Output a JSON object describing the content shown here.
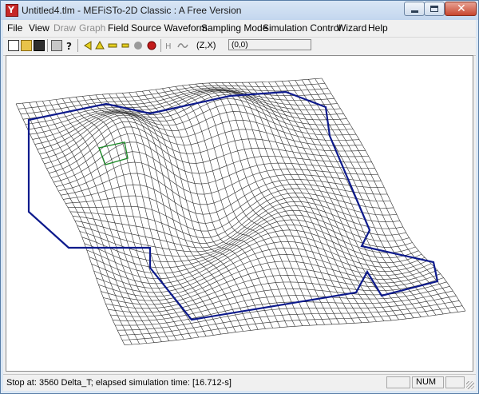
{
  "window": {
    "title": "Untitled4.tlm - MEFiSTo-2D Classic : A Free Version",
    "app_icon_glyph": "Y"
  },
  "menu": [
    {
      "label": "File",
      "enabled": true
    },
    {
      "label": "View",
      "enabled": true
    },
    {
      "label": "Draw",
      "enabled": false
    },
    {
      "label": "Graph",
      "enabled": false
    },
    {
      "label": "Field",
      "enabled": true
    },
    {
      "label": "Source Waveform",
      "enabled": true
    },
    {
      "label": "Sampling Mode",
      "enabled": true
    },
    {
      "label": "Simulation Control",
      "enabled": true
    },
    {
      "label": "Wizard",
      "enabled": true
    },
    {
      "label": "Help",
      "enabled": true
    }
  ],
  "toolbar": {
    "buttons": [
      "new-file-icon",
      "open-folder-icon",
      "save-icon",
      "print-icon",
      "help-question-icon",
      "step-back-icon",
      "step-up-icon",
      "zoom-out-icon",
      "stop-icon",
      "pause-icon",
      "record-icon",
      "run-probe-icon",
      "waveform-icon"
    ],
    "coord_label": "(Z,X)",
    "coord_value": "(0,0)"
  },
  "status": {
    "message": "Stop at: 3560 Delta_T;   elapsed simulation time: [16.712-s]",
    "indicator": "NUM"
  },
  "colors": {
    "mesh": "#2b2b2b",
    "boundary": "#0d1a8c",
    "probe": "#1f8a2a",
    "record": "#c21a1a"
  }
}
